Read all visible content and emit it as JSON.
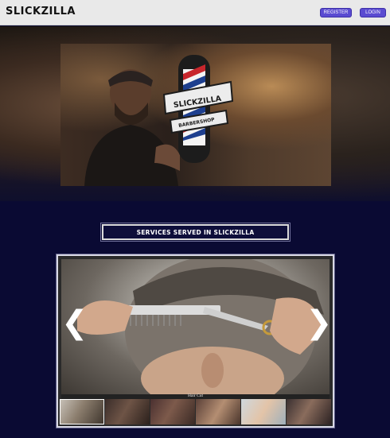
{
  "header": {
    "brand": "SLICKZILLA",
    "register_label": "REGISTER",
    "login_label": "LOGIN",
    "accent_color": "#5a4bd1"
  },
  "hero": {
    "logo_title": "SLICKZILLA",
    "logo_subtitle": "BARBERSHOP"
  },
  "services": {
    "title": "SERVICES SERVED IN SLICKZILLA"
  },
  "carousel": {
    "prev_icon": "chevron-left-icon",
    "next_icon": "chevron-right-icon",
    "prev_glyph": "❮",
    "next_glyph": "❯",
    "caption": "Hair Cut",
    "active_index": 0,
    "thumbnail_count": 6
  },
  "colors": {
    "page_background": "#0a0a33",
    "header_background": "#e9e9e9"
  }
}
